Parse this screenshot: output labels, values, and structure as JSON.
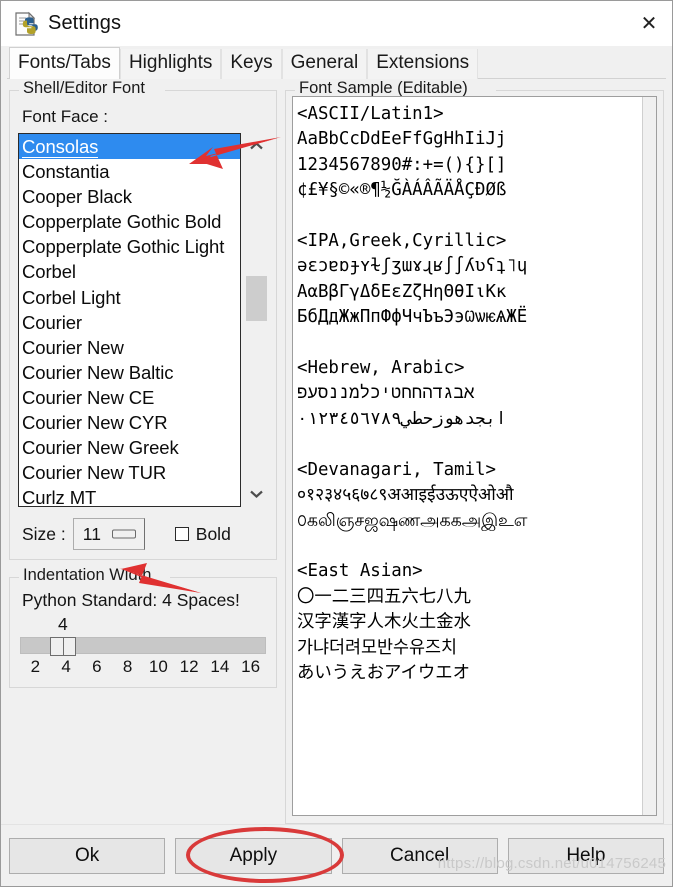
{
  "window": {
    "title": "Settings",
    "icon": "python-document-icon",
    "close_label": "✕"
  },
  "tabs": [
    {
      "label": "Fonts/Tabs",
      "active": true
    },
    {
      "label": "Highlights",
      "active": false
    },
    {
      "label": "Keys",
      "active": false
    },
    {
      "label": "General",
      "active": false
    },
    {
      "label": "Extensions",
      "active": false
    }
  ],
  "font_group": {
    "title": "Shell/Editor Font",
    "face_label": "Font Face :",
    "selected_face": "Consolas",
    "faces": [
      "Consolas",
      "Constantia",
      "Cooper Black",
      "Copperplate Gothic Bold",
      "Copperplate Gothic Light",
      "Corbel",
      "Corbel Light",
      "Courier",
      "Courier New",
      "Courier New Baltic",
      "Courier New CE",
      "Courier New CYR",
      "Courier New Greek",
      "Courier New TUR",
      "Curlz MT"
    ],
    "size_label": "Size :",
    "size_value": "11",
    "bold_label": "Bold",
    "bold_checked": false,
    "scroll_up_icon": "chevron-up-icon",
    "scroll_down_icon": "chevron-down-icon"
  },
  "indent_group": {
    "title": "Indentation Width",
    "note": "Python Standard: 4 Spaces!",
    "value": "4",
    "ticks": [
      "2",
      "4",
      "6",
      "8",
      "10",
      "12",
      "14",
      "16"
    ]
  },
  "sample_group": {
    "title": "Font Sample (Editable)",
    "text": "<ASCII/Latin1>\nAaBbCcDdEeFfGgHhIiJj\n1234567890#:+=(){}[]\n¢£¥§©«®¶½ĞÀÁÂÃÄÅÇÐØß\n\n<IPA,Greek,Cyrillic>\nəɛɔɐɒɟʏɫʃʒɯɤɻʁ∫∫ʎʋʕʇ˥ɥ\nAαBβΓγΔδEεZζHηΘθIιKκ\nБбДдЖжПпФфЧчЪъЭэѠѡѥѦЖЁ\n\n<Hebrew, Arabic>\nאבגדהחחטיכלמננסעפ\nابجدهوزحطي٠١٢٣٤٥٦٧٨٩\n\n<Devanagari, Tamil>\n०१२३४५६७८९अआइईउऊएऐओऔ\n௦கலிஞசஜஷணஅககஅஇஉஎ\n\n<East Asian>\n〇一二三四五六七八九\n汉字漢字人木火土金水\n가냐더려모반수유즈치\nあいうえおアイウエオ"
  },
  "buttons": [
    {
      "label": "Ok",
      "name": "ok-button"
    },
    {
      "label": "Apply",
      "name": "apply-button"
    },
    {
      "label": "Cancel",
      "name": "cancel-button"
    },
    {
      "label": "Help",
      "name": "help-button"
    }
  ],
  "annotations": {
    "watermark": "https://blog.csdn.net/u014756245",
    "highlight_color": "#d93a3a",
    "arrow_to_font_list": "red-arrow-pointing-to-selected-font",
    "arrow_to_size": "red-arrow-pointing-to-size-spinner",
    "ellipse_around": "Apply"
  },
  "colors": {
    "selection_blue": "#2e8bef",
    "window_bg": "#f0f0f0",
    "annotation_red": "#d93a3a"
  }
}
